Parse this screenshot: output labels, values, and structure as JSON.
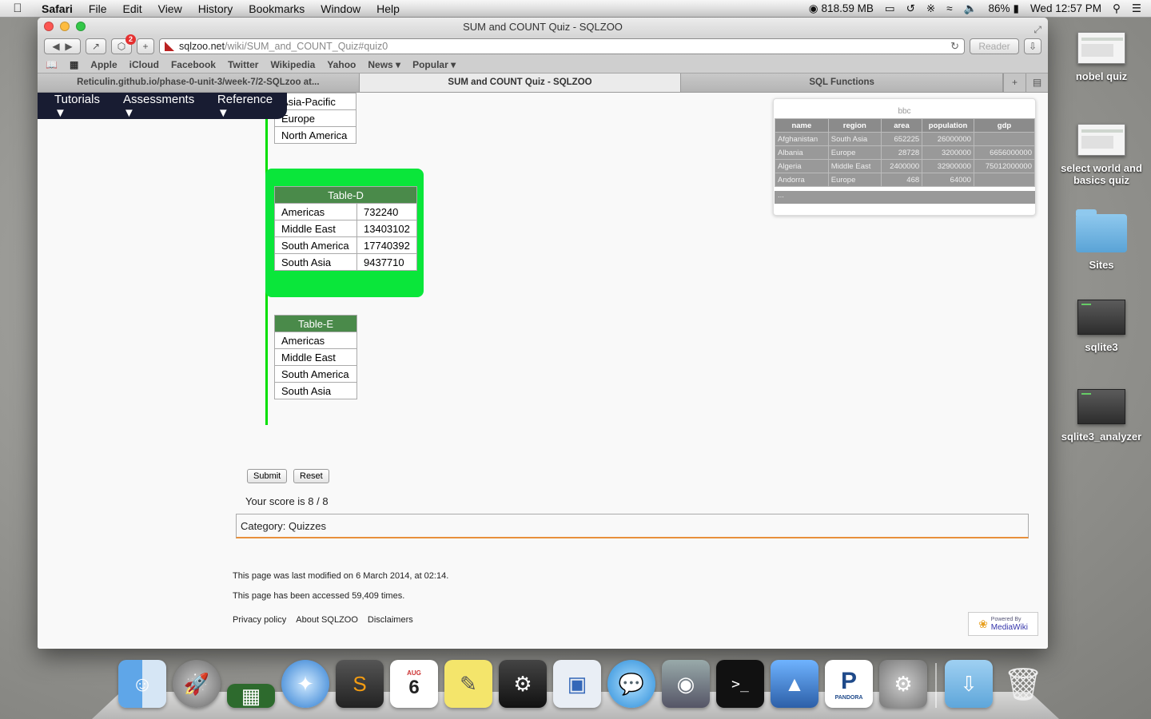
{
  "menubar": {
    "app": "Safari",
    "items": [
      "File",
      "Edit",
      "View",
      "History",
      "Bookmarks",
      "Window",
      "Help"
    ],
    "memory": "818.59 MB",
    "battery": "86%",
    "clock": "Wed 12:57 PM"
  },
  "window": {
    "title": "SUM and COUNT Quiz - SQLZOO",
    "adblock_count": "2",
    "url_host": "sqlzoo.net",
    "url_path": "/wiki/SUM_and_COUNT_Quiz#quiz0",
    "reader_label": "Reader"
  },
  "bookmarks": [
    "Apple",
    "iCloud",
    "Facebook",
    "Twitter",
    "Wikipedia",
    "Yahoo",
    "News ▾",
    "Popular ▾"
  ],
  "tabs": [
    {
      "label": "Reticulin.github.io/phase-0-unit-3/week-7/2-SQLzoo at..."
    },
    {
      "label": "SUM and COUNT Quiz - SQLZOO"
    },
    {
      "label": "SQL Functions"
    }
  ],
  "sitenav": {
    "tutorials": "Tutorials ▼",
    "assessments": "Assessments ▼",
    "reference": "Reference ▼"
  },
  "tableC": {
    "rows": [
      "Asia-Pacific",
      "Europe",
      "North America"
    ]
  },
  "tableD": {
    "header": "Table-D",
    "rows": [
      {
        "region": "Americas",
        "value": "732240"
      },
      {
        "region": "Middle East",
        "value": "13403102"
      },
      {
        "region": "South America",
        "value": "17740392"
      },
      {
        "region": "South Asia",
        "value": "9437710"
      }
    ]
  },
  "tableE": {
    "header": "Table-E",
    "rows": [
      "Americas",
      "Middle East",
      "South America",
      "South Asia"
    ]
  },
  "bbc": {
    "title": "bbc",
    "columns": [
      "name",
      "region",
      "area",
      "population",
      "gdp"
    ],
    "rows": [
      [
        "Afghanistan",
        "South Asia",
        "652225",
        "26000000",
        ""
      ],
      [
        "Albania",
        "Europe",
        "28728",
        "3200000",
        "6656000000"
      ],
      [
        "Algeria",
        "Middle East",
        "2400000",
        "32900000",
        "75012000000"
      ],
      [
        "Andorra",
        "Europe",
        "468",
        "64000",
        ""
      ]
    ],
    "more": "..."
  },
  "quiz": {
    "submit": "Submit",
    "reset": "Reset",
    "score": "Your score is 8 / 8",
    "category_label": "Category:",
    "category_value": "Quizzes"
  },
  "footer": {
    "modified": "This page was last modified on 6 March 2014, at 02:14.",
    "accessed": "This page has been accessed 59,409 times.",
    "links": [
      "Privacy policy",
      "About SQLZOO",
      "Disclaimers"
    ],
    "powered_small": "Powered By",
    "powered_big": "MediaWiki"
  },
  "desktop": [
    "nobel quiz",
    "select world and basics quiz",
    "Sites",
    "sqlite3",
    "sqlite3_analyzer"
  ],
  "colors": {
    "quiz_selected": "#0ae63a",
    "table_header": "#4a8a4a",
    "nav_bg": "#181c32",
    "category_border": "#e8903c"
  },
  "dock": [
    "finder-icon",
    "launchpad-icon",
    "memory-icon",
    "safari-icon",
    "sublime-icon",
    "calendar-icon",
    "stickies-icon",
    "steam-icon",
    "preview-icon",
    "messages-icon",
    "facetime-icon",
    "terminal-icon",
    "keynote-icon",
    "pandora-icon",
    "system-preferences-icon",
    "downloads-icon",
    "trash-icon"
  ],
  "calendar": {
    "month": "AUG",
    "day": "6"
  },
  "pandora_label": "PANDORA"
}
